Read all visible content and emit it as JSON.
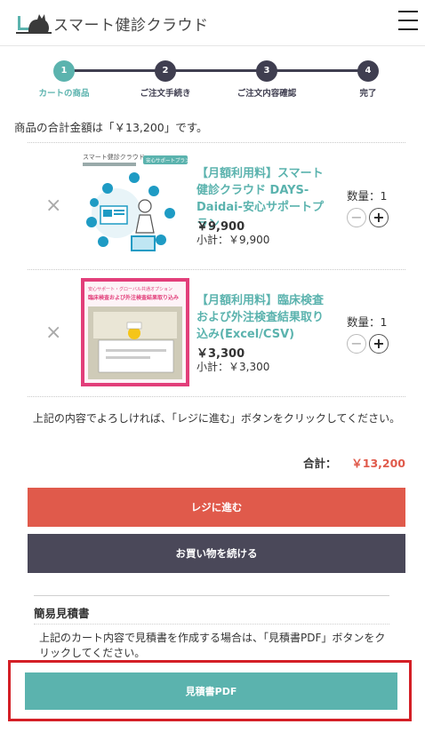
{
  "header": {
    "logo_text": "スマート健診クラウド"
  },
  "steps": [
    {
      "number": "1",
      "label": "カートの商品",
      "active": true
    },
    {
      "number": "2",
      "label": "ご注文手続き",
      "active": false
    },
    {
      "number": "3",
      "label": "ご注文内容確認",
      "active": false
    },
    {
      "number": "4",
      "label": "完了",
      "active": false
    }
  ],
  "cart": {
    "summary": "商品の合計金額は「￥13,200」です。",
    "items": [
      {
        "remove_icon": "×",
        "name": "【月額利用料】スマート健診クラウド DAYS-Daidai-安心サポートプラン",
        "price": "￥9,900",
        "subtotal": "小計：￥9,900",
        "quantity": "数量：1",
        "thumb": {
          "brand": "スマート健診クラウド",
          "badge": "安心サポートプラン"
        }
      },
      {
        "remove_icon": "×",
        "name": "【月額利用料】臨床検査および外注検査結果取り込み(Excel/CSV)",
        "price": "￥3,300",
        "subtotal": "小計：￥3,300",
        "quantity": "数量：1",
        "thumb": {
          "caption1": "安心サポート・グローバル共通オプション",
          "caption2": "臨床検査および外注検査結果取り込み"
        }
      }
    ],
    "note": "上記の内容でよろしければ、「レジに進む」ボタンをクリックしてください。",
    "total_label": "合計：",
    "total_value": "￥13,200",
    "checkout_label": "レジに進む",
    "continue_label": "お買い物を続ける"
  },
  "estimate": {
    "title": "簡易見積書",
    "note": "上記のカート内容で見積書を作成する場合は、「見積書PDF」ボタンをクリックしてください。",
    "pdf_label": "見積書PDF"
  },
  "colors": {
    "accent": "#5bb3ae",
    "checkout": "#e05a4b",
    "dark": "#4a4859",
    "highlight": "#d41f26"
  }
}
